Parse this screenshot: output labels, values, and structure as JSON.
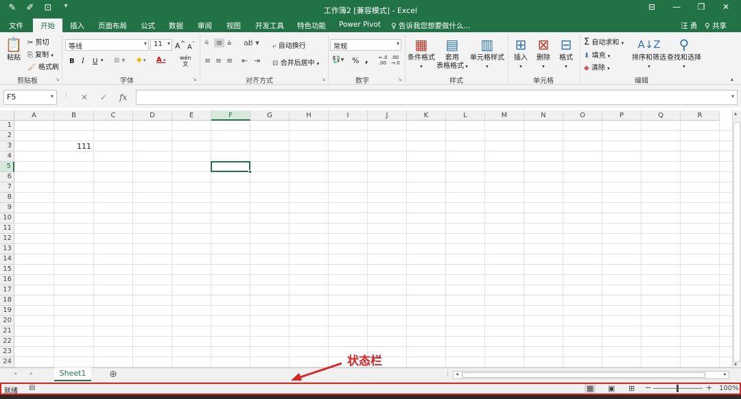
{
  "window": {
    "title": "工作簿2  [兼容模式] - Excel",
    "qat_icons": [
      "pen-icon",
      "brush-icon",
      "screenshot-icon",
      "customize-qat-icon"
    ],
    "controls": [
      "ribbon-display-icon",
      "minimize-icon",
      "restore-icon",
      "close-icon"
    ]
  },
  "menu": {
    "tabs": [
      "文件",
      "开始",
      "插入",
      "页面布局",
      "公式",
      "数据",
      "审阅",
      "视图",
      "开发工具",
      "特色功能",
      "Power Pivot"
    ],
    "active_tab": "开始",
    "tell_me": "告诉我您想要做什么...",
    "user": "汪 勇",
    "share": "共享"
  },
  "ribbon": {
    "clipboard": {
      "paste": "粘贴",
      "cut": "剪切",
      "copy": "复制",
      "format_painter": "格式刷",
      "label": "剪贴板"
    },
    "font": {
      "name": "等线",
      "size": "11",
      "bold": "B",
      "italic": "I",
      "underline": "U",
      "grow": "A",
      "shrink": "A",
      "phonetic": "wén",
      "label": "字体"
    },
    "alignment": {
      "wrap": "自动换行",
      "merge": "合并后居中",
      "label": "对齐方式"
    },
    "number": {
      "format": "常规",
      "percent": "%",
      "comma": ",",
      "label": "数字"
    },
    "styles": {
      "conditional": "条件格式",
      "table_format_1": "套用",
      "table_format_2": "表格格式",
      "cell_styles": "单元格样式",
      "label": "样式"
    },
    "cells": {
      "insert": "插入",
      "delete": "删除",
      "format": "格式",
      "label": "单元格"
    },
    "editing": {
      "autosum": "自动求和",
      "fill": "填充",
      "clear": "清除",
      "sort": "排序和筛选",
      "find": "查找和选择",
      "label": "编辑"
    }
  },
  "formula_bar": {
    "name_box": "F5",
    "fx": "fx",
    "value": ""
  },
  "sheet": {
    "columns": [
      "A",
      "B",
      "C",
      "D",
      "E",
      "F",
      "G",
      "H",
      "I",
      "J",
      "K",
      "L",
      "M",
      "N",
      "O",
      "P",
      "Q",
      "R"
    ],
    "rows": [
      "1",
      "2",
      "3",
      "4",
      "5",
      "6",
      "7",
      "8",
      "9",
      "10",
      "11",
      "12",
      "13",
      "14",
      "15",
      "16",
      "17",
      "18",
      "19",
      "20",
      "21",
      "22",
      "23",
      "24"
    ],
    "selected_cell": "F5",
    "cells": {
      "B3": "111"
    },
    "tabs": [
      "Sheet1"
    ],
    "add_sheet": "⊕"
  },
  "status_bar": {
    "ready": "就绪",
    "zoom": "100%"
  },
  "annotation": {
    "text": "状态栏"
  },
  "colors": {
    "accent": "#217346",
    "annotation": "#e02020"
  }
}
